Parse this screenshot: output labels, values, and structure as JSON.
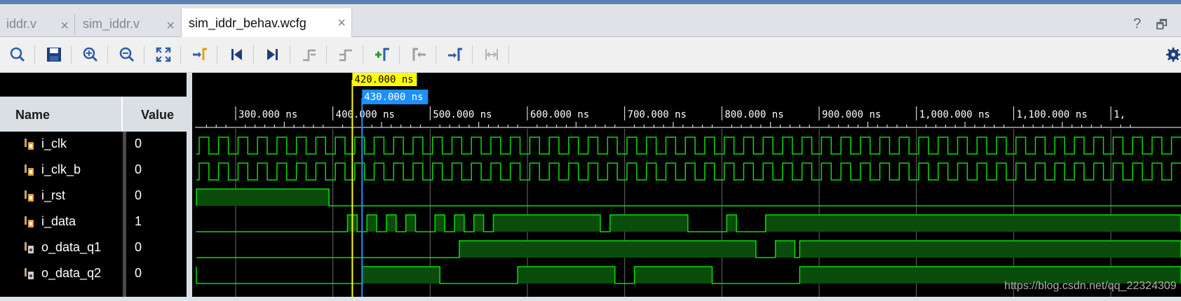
{
  "tabs": [
    {
      "label": "iddr.v",
      "active": false
    },
    {
      "label": "sim_iddr.v",
      "active": false
    },
    {
      "label": "sim_iddr_behav.wcfg",
      "active": true
    }
  ],
  "window_controls": {
    "help": "?",
    "restore": "🗗"
  },
  "toolbar_icons": [
    "search-icon",
    "save-icon",
    "zoom-in-icon",
    "zoom-out-icon",
    "zoom-fit-icon",
    "go-to-cursor-icon",
    "go-to-time-zero-icon",
    "go-to-last-time-icon",
    "previous-transition-icon",
    "next-transition-icon",
    "add-marker-icon",
    "previous-marker-icon",
    "next-marker-icon",
    "swap-cursors-icon",
    "settings-icon"
  ],
  "columns": {
    "name": "Name",
    "value": "Value"
  },
  "signals": [
    {
      "name": "i_clk",
      "value": "0",
      "type": "input"
    },
    {
      "name": "i_clk_b",
      "value": "0",
      "type": "input"
    },
    {
      "name": "i_rst",
      "value": "0",
      "type": "input"
    },
    {
      "name": "i_data",
      "value": "1",
      "type": "input"
    },
    {
      "name": "o_data_q1",
      "value": "0",
      "type": "output"
    },
    {
      "name": "o_data_q2",
      "value": "0",
      "type": "output"
    }
  ],
  "cursors": {
    "primary": "420.000 ns",
    "secondary": "430.000 ns"
  },
  "timeline_ticks": [
    "300.000 ns",
    "400.000 ns",
    "500.000 ns",
    "600.000 ns",
    "700.000 ns",
    "800.000 ns",
    "900.000 ns",
    "1,000.000 ns",
    "1,100.000 ns",
    "1,"
  ],
  "watermark": "https://blog.csdn.net/qq_22324309",
  "colors": {
    "wave": "#00e000",
    "wave_fill": "#0a4d0a",
    "cursor_primary": "#ffff00",
    "cursor_secondary": "#1e90ff"
  }
}
